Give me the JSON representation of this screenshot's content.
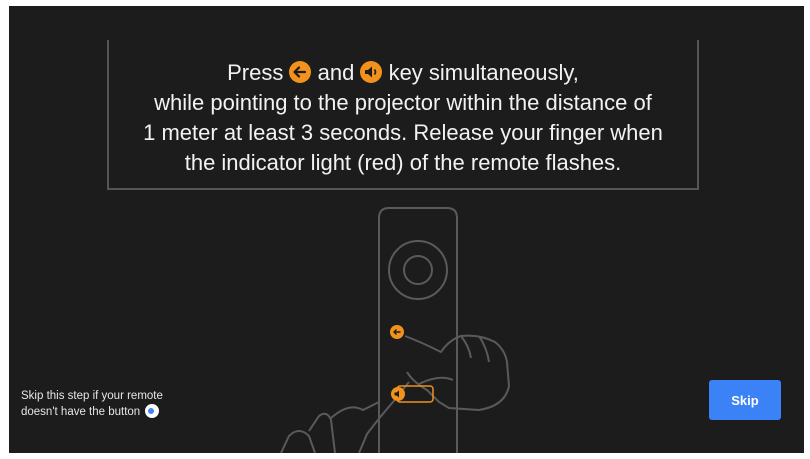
{
  "instructions": {
    "line1_press": "Press",
    "line1_and": "and",
    "line1_rest": "key simultaneously,",
    "line2": "while pointing to the projector within the distance of",
    "line3": "1 meter at least 3 seconds. Release your finger when",
    "line4": "the indicator light (red) of the remote flashes.",
    "icon1": "back-arrow-icon",
    "icon2": "volume-down-icon",
    "icon_color": "#f2921c"
  },
  "skip_note": {
    "line1": "Skip this step if your remote",
    "line2": "doesn't have the button",
    "icon": "google-assistant-icon"
  },
  "skip_button": {
    "label": "Skip",
    "color": "#3b82f6"
  },
  "colors": {
    "background": "#1c1c1c",
    "outline": "#555555",
    "accent": "#f2921c"
  }
}
